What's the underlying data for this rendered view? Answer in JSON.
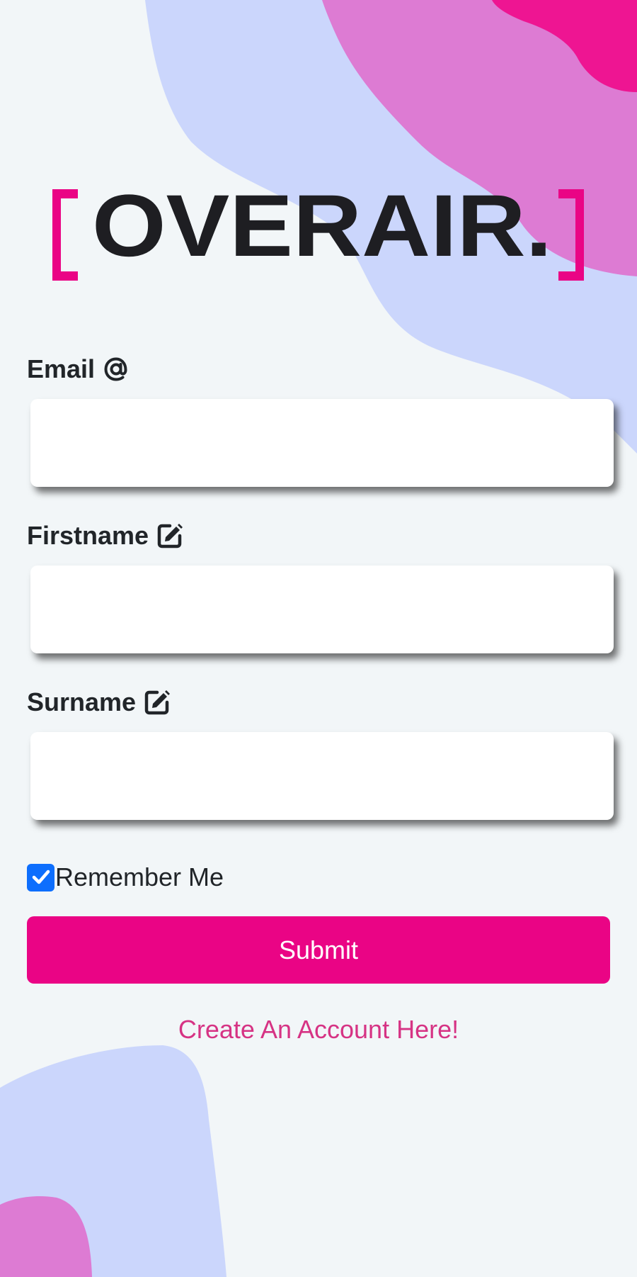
{
  "brand": {
    "name": "OVERAIR.",
    "accent_color": "#ea0485",
    "bracket_color": "#ea0485"
  },
  "form": {
    "email": {
      "label": "Email",
      "icon": "at-icon",
      "value": "",
      "placeholder": ""
    },
    "firstname": {
      "label": "Firstname",
      "icon": "edit-icon",
      "value": "",
      "placeholder": ""
    },
    "surname": {
      "label": "Surname",
      "icon": "edit-icon",
      "value": "",
      "placeholder": ""
    },
    "remember": {
      "label": "Remember Me",
      "checked": true
    },
    "submit_label": "Submit",
    "create_account_link": "Create An Account Here!"
  },
  "colors": {
    "background": "#f2f6f8",
    "blob_lavender": "#cbd6fc",
    "blob_pink": "#dd7bd3",
    "blob_magenta": "#ee1592",
    "link": "#d63384",
    "checkbox": "#0d6efd"
  }
}
